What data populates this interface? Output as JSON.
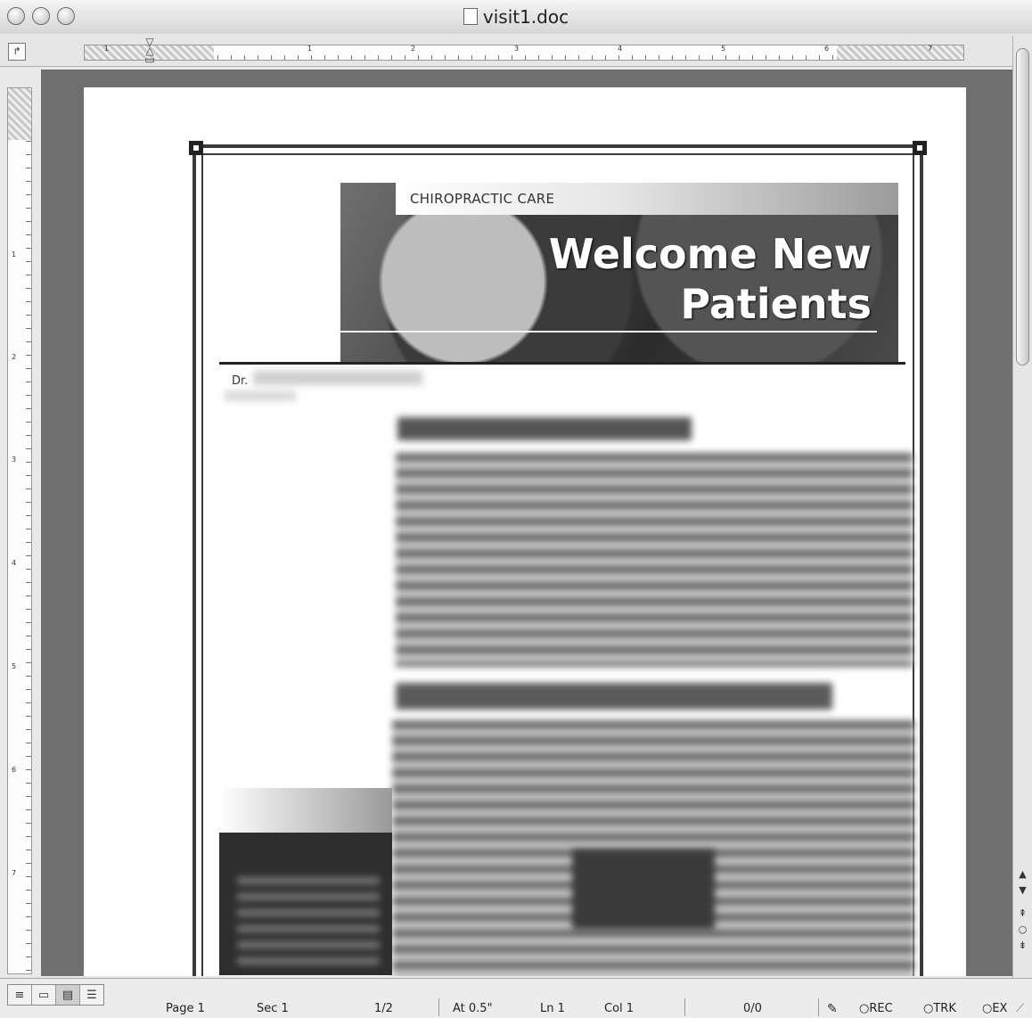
{
  "window": {
    "title": "visit1.doc"
  },
  "ruler": {
    "tab_selector_glyph": "↱",
    "numbers": [
      "1",
      "1",
      "2",
      "3",
      "4",
      "5",
      "6",
      "7"
    ],
    "vertical_numbers": [
      "1",
      "2",
      "3",
      "4",
      "5",
      "6",
      "7"
    ]
  },
  "document": {
    "banner_small": "CHIROPRACTIC CARE",
    "banner_title_line1": "Welcome New",
    "banner_title_line2": "Patients",
    "doctor_label": "Dr."
  },
  "status": {
    "page": "Page  1",
    "sec": "Sec  1",
    "page_of": "1/2",
    "at": "At  0.5\"",
    "ln": "Ln  1",
    "col": "Col  1",
    "count": "0/0",
    "rec": "REC",
    "trk": "TRK",
    "ext": "EX"
  },
  "view_modes": [
    "normal-view",
    "online-layout-view",
    "page-layout-view",
    "outline-view"
  ],
  "colors": {
    "canvas": "#6f6f6f",
    "frame": "#3a3a3a"
  }
}
